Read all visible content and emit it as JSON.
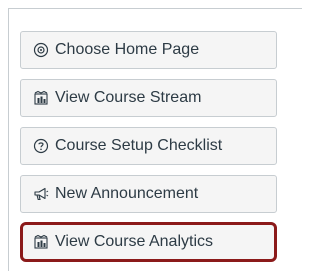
{
  "sidebar": {
    "buttons": [
      {
        "label": "Choose Home Page",
        "icon": "home-page-icon"
      },
      {
        "label": "View Course Stream",
        "icon": "stream-icon"
      },
      {
        "label": "Course Setup Checklist",
        "icon": "question-circle-icon"
      },
      {
        "label": "New Announcement",
        "icon": "megaphone-icon"
      },
      {
        "label": "View Course Analytics",
        "icon": "analytics-icon"
      }
    ],
    "highlight_color": "#8b1a1a"
  }
}
